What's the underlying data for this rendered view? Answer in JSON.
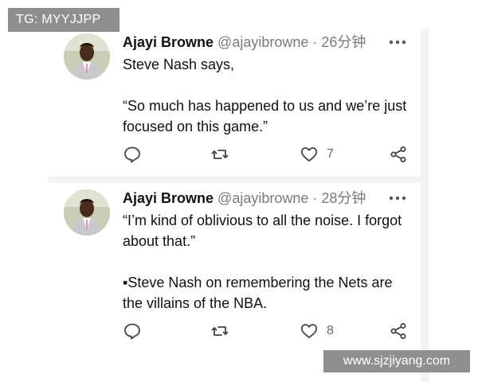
{
  "watermark_top": "TG: MYYJJPP",
  "watermark_bottom": "www.sjzjiyang.com",
  "tweets": [
    {
      "name": "Ajayi Browne",
      "handle": "@ajayibrowne",
      "separator": "·",
      "time": "26分钟",
      "paragraphs": [
        "Steve Nash says,",
        "“So much has happened to us and we’re just focused on this game.”"
      ],
      "like_count": "7",
      "icons": [
        "reply-icon",
        "retweet-icon",
        "like-icon",
        "share-icon",
        "more-icon"
      ]
    },
    {
      "name": "Ajayi Browne",
      "handle": "@ajayibrowne",
      "separator": "·",
      "time": "28分钟",
      "paragraphs": [
        "“I’m kind of oblivious to all the noise. I forgot about that.”",
        "▪Steve Nash on remembering the Nets are the villains of the NBA."
      ],
      "like_count": "8",
      "icons": [
        "reply-icon",
        "retweet-icon",
        "like-icon",
        "share-icon",
        "more-icon"
      ]
    }
  ]
}
